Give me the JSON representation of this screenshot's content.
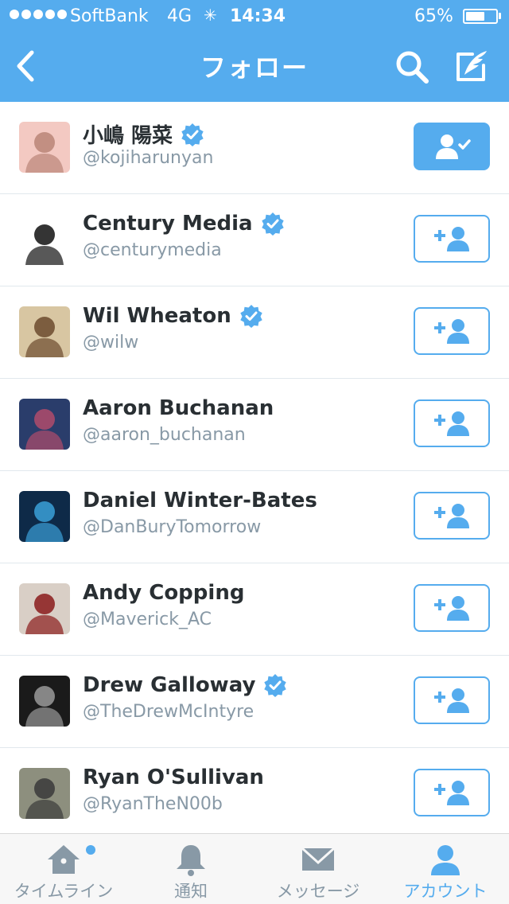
{
  "status_bar": {
    "carrier": "SoftBank",
    "network": "4G",
    "activity_glyph": "✳",
    "time": "14:34",
    "battery_text": "65%",
    "battery_level": 0.65
  },
  "nav": {
    "title": "フォロー",
    "back_icon": "chevron-left-icon",
    "search_icon": "search-icon",
    "compose_icon": "compose-icon"
  },
  "users": [
    {
      "name": "小嶋 陽菜",
      "handle": "@kojiharunyan",
      "verified": true,
      "following": true,
      "avatar_colors": [
        "#f3c9c2",
        "#b98577"
      ]
    },
    {
      "name": "Century Media",
      "handle": "@centurymedia",
      "verified": true,
      "following": false,
      "avatar_colors": [
        "#ffffff",
        "#111111"
      ]
    },
    {
      "name": "Wil Wheaton",
      "handle": "@wilw",
      "verified": true,
      "following": false,
      "avatar_colors": [
        "#d8c6a2",
        "#6c4a2e"
      ]
    },
    {
      "name": "Aaron Buchanan",
      "handle": "@aaron_buchanan",
      "verified": false,
      "following": false,
      "avatar_colors": [
        "#2a3d6b",
        "#b04b6b"
      ]
    },
    {
      "name": "Daniel Winter-Bates",
      "handle": "@DanBuryTomorrow",
      "verified": false,
      "following": false,
      "avatar_colors": [
        "#0e2a48",
        "#3aa0d8"
      ]
    },
    {
      "name": "Andy Copping",
      "handle": "@Maverick_AC",
      "verified": false,
      "following": false,
      "avatar_colors": [
        "#d9cfc6",
        "#8a1b1b"
      ]
    },
    {
      "name": "Drew Galloway",
      "handle": "@TheDrewMcIntyre",
      "verified": true,
      "following": false,
      "avatar_colors": [
        "#1a1a1a",
        "#9a9a9a"
      ]
    },
    {
      "name": "Ryan O'Sullivan",
      "handle": "@RyanTheN00b",
      "verified": false,
      "following": false,
      "avatar_colors": [
        "#8d8f7e",
        "#3a3a3a"
      ]
    }
  ],
  "tabs": [
    {
      "label": "タイムライン",
      "icon": "home-icon",
      "active": false,
      "has_dot": true
    },
    {
      "label": "通知",
      "icon": "bell-icon",
      "active": false,
      "has_dot": false
    },
    {
      "label": "メッセージ",
      "icon": "envelope-icon",
      "active": false,
      "has_dot": false
    },
    {
      "label": "アカウント",
      "icon": "person-icon",
      "active": true,
      "has_dot": false
    }
  ],
  "colors": {
    "accent": "#55acee",
    "text": "#292f33",
    "muted": "#8899a6",
    "divider": "#e1e8ed"
  }
}
